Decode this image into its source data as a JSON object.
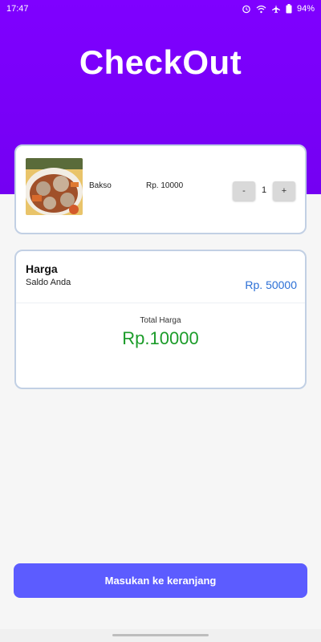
{
  "status_bar": {
    "time": "17:47",
    "battery": "94%"
  },
  "header": {
    "title": "CheckOut",
    "accent_color": "#7f00ff"
  },
  "item": {
    "name": "Bakso",
    "price": "Rp. 10000",
    "quantity": "1",
    "decrement_label": "-",
    "increment_label": "+"
  },
  "pricing": {
    "heading": "Harga",
    "balance_label": "Saldo Anda",
    "balance_value": "Rp. 50000",
    "total_label": "Total Harga",
    "total_value": "Rp.10000"
  },
  "actions": {
    "add_to_cart_label": "Masukan ke keranjang",
    "button_color": "#5c5cff"
  },
  "colors": {
    "balance_text": "#2b6fd6",
    "total_text": "#1c9c2a"
  }
}
